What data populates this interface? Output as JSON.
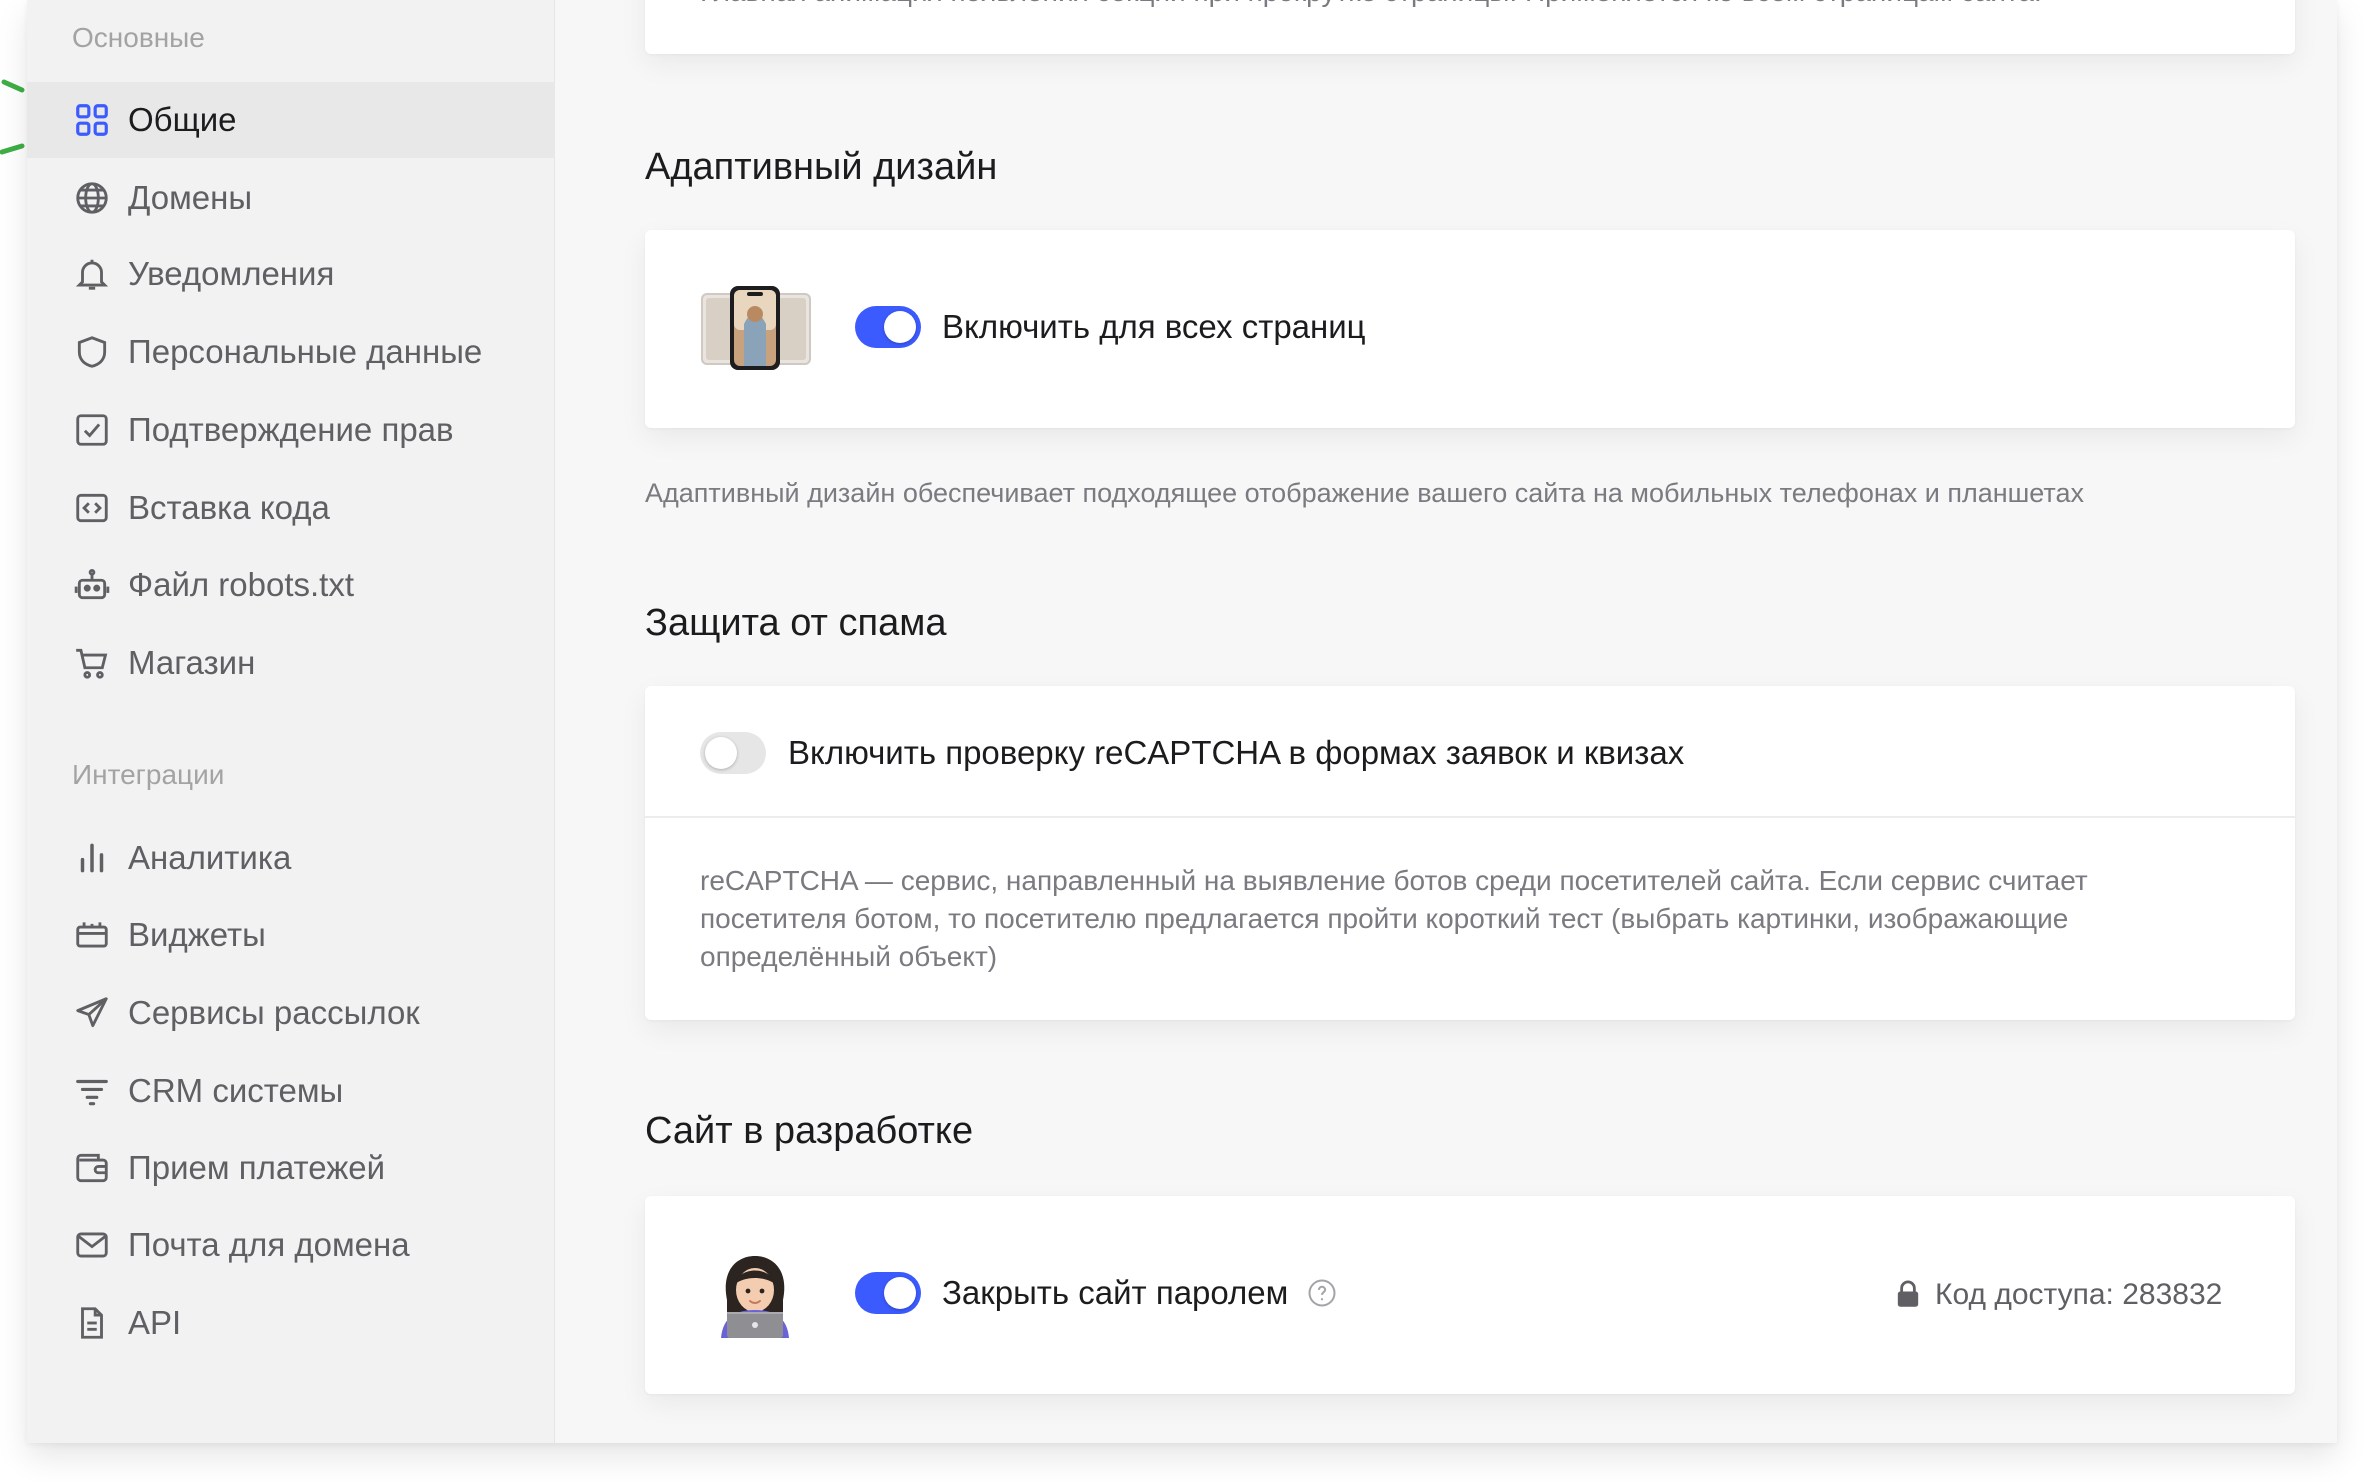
{
  "sidebar": {
    "main_section": "Основные",
    "integrations_section": "Интеграции",
    "items": [
      {
        "label": "Общие",
        "icon": "grid-icon"
      },
      {
        "label": "Домены",
        "icon": "globe-icon"
      },
      {
        "label": "Уведомления",
        "icon": "bell-icon"
      },
      {
        "label": "Персональные данные",
        "icon": "shield-icon"
      },
      {
        "label": "Подтверждение прав",
        "icon": "checkbox-icon"
      },
      {
        "label": "Вставка кода",
        "icon": "code-icon"
      },
      {
        "label": "Файл robots.txt",
        "icon": "robot-icon"
      },
      {
        "label": "Магазин",
        "icon": "cart-icon"
      }
    ],
    "integrations": [
      {
        "label": "Аналитика",
        "icon": "bar-chart-icon"
      },
      {
        "label": "Виджеты",
        "icon": "widget-icon"
      },
      {
        "label": "Сервисы рассылок",
        "icon": "send-icon"
      },
      {
        "label": "CRM системы",
        "icon": "filter-icon"
      },
      {
        "label": "Прием платежей",
        "icon": "wallet-icon"
      },
      {
        "label": "Почта для домена",
        "icon": "mail-icon"
      },
      {
        "label": "API",
        "icon": "document-icon"
      }
    ]
  },
  "main": {
    "top_text": "Главная анимация появления секций при прокрутке страницы. Применяется ко всем страницам сайта.",
    "adaptive": {
      "title": "Адаптивный дизайн",
      "toggle_label": "Включить для всех страниц",
      "toggle_on": true,
      "hint": "Адаптивный дизайн обеспечивает подходящее отображение вашего сайта на мобильных телефонах и планшетах",
      "image_icon": "phone-preview-icon"
    },
    "spam": {
      "title": "Защита от спама",
      "toggle_label": "Включить проверку reCAPTCHA в формах заявок и квизах",
      "toggle_on": false,
      "description": "reCAPTCHA — сервис, направленный на выявление ботов среди посетителей сайта. Если сервис считает посетителя ботом, то посетителю предлагается пройти короткий тест (выбрать картинки, изображающие определённый объект)"
    },
    "dev": {
      "title": "Сайт в разработке",
      "toggle_label": "Закрыть сайт паролем",
      "toggle_on": true,
      "help_icon": "question-icon",
      "access_code": "Код доступа: 283832",
      "lock_icon": "lock-icon",
      "avatar_icon": "developer-emoji-icon"
    }
  },
  "colors": {
    "accent": "#3b5bff",
    "highlight": "#3fae45",
    "sidebar_bg": "#f2f2f2",
    "active_bg": "#e8e8e8"
  }
}
